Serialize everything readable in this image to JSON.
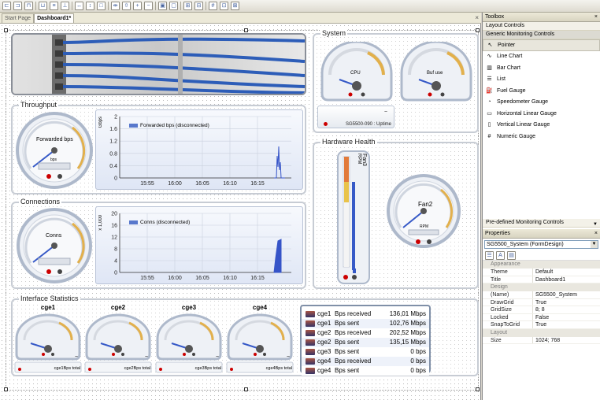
{
  "tabs": [
    {
      "label": "Start Page"
    },
    {
      "label": "Dashboard1*"
    }
  ],
  "panels": {
    "system": "System",
    "throughput": "Throughput",
    "connections": "Connections",
    "hardware_health": "Hardware Health",
    "interface_statistics": "Interface Statistics"
  },
  "system": {
    "cpu_label": "CPU",
    "buf_label": "Buf use",
    "uptime_label": "SG5500-090 : Uptime"
  },
  "throughput": {
    "gauge_label": "Forwarded bps",
    "gauge_sub": "bps",
    "chart_data": {
      "type": "line",
      "ylabel": "Gbps",
      "y_ticks": [
        "2",
        "1.6",
        "1.2",
        "0.8",
        "0.4",
        "0"
      ],
      "x_ticks": [
        "15:55",
        "16:00",
        "16:05",
        "16:10",
        "16:15"
      ],
      "legend": "Forwarded bps (disconnected)",
      "ylim": [
        0,
        2
      ]
    }
  },
  "connections": {
    "gauge_label": "Conns",
    "chart_data": {
      "type": "area",
      "ylabel": "x 1,000",
      "y_ticks": [
        "20",
        "16",
        "12",
        "8",
        "4",
        "0"
      ],
      "x_ticks": [
        "15:55",
        "16:00",
        "16:05",
        "16:10",
        "16:15"
      ],
      "legend": "Conns (disconnected)",
      "ylim": [
        0,
        20
      ]
    }
  },
  "hardware": {
    "fan3_label": "Fan3",
    "rpm_label": "RPM",
    "fan2_label": "Fan2",
    "fan2_rpm": "RPM"
  },
  "interfaces": [
    {
      "name": "cge1",
      "footer": "cge1Bps total"
    },
    {
      "name": "cge2",
      "footer": "cge2Bps total"
    },
    {
      "name": "cge3",
      "footer": "cge3Bps total"
    },
    {
      "name": "cge4",
      "footer": "cge4Bps total"
    }
  ],
  "interface_table": [
    {
      "name": "cge1",
      "metric": "Bps received",
      "value": "136,01 Mbps"
    },
    {
      "name": "cge1",
      "metric": "Bps sent",
      "value": "102,76 Mbps"
    },
    {
      "name": "cge2",
      "metric": "Bps received",
      "value": "202,52 Mbps"
    },
    {
      "name": "cge2",
      "metric": "Bps sent",
      "value": "135,15 Mbps"
    },
    {
      "name": "cge3",
      "metric": "Bps sent",
      "value": "0 bps"
    },
    {
      "name": "cge4",
      "metric": "Bps received",
      "value": "0 bps"
    },
    {
      "name": "cge4",
      "metric": "Bps sent",
      "value": "0 bps"
    }
  ],
  "toolbox": {
    "title": "Toolbox",
    "sections": [
      "Layout Controls",
      "Generic Monitoring Controls"
    ],
    "items": [
      {
        "label": "Pointer",
        "icon": "pointer-icon"
      },
      {
        "label": "Line Chart",
        "icon": "line-chart-icon"
      },
      {
        "label": "Bar Chart",
        "icon": "bar-chart-icon"
      },
      {
        "label": "List",
        "icon": "list-icon"
      },
      {
        "label": "Fuel Gauge",
        "icon": "fuel-gauge-icon"
      },
      {
        "label": "Speedometer Gauge",
        "icon": "speedometer-icon"
      },
      {
        "label": "Horizontal Linear Gauge",
        "icon": "horizontal-gauge-icon"
      },
      {
        "label": "Vertical Linear Gauge",
        "icon": "vertical-gauge-icon"
      },
      {
        "label": "Numeric Gauge",
        "icon": "numeric-gauge-icon"
      }
    ],
    "footer_section": "Pre-defined Monitoring Controls"
  },
  "properties": {
    "title": "Properties",
    "object": "SG5500_System (FormDesign)",
    "categories": [
      {
        "name": "Appearance",
        "rows": [
          {
            "k": "Theme",
            "v": "Default"
          },
          {
            "k": "Title",
            "v": "Dashboard1"
          }
        ]
      },
      {
        "name": "Design",
        "rows": [
          {
            "k": "(Name)",
            "v": "SG5500_System"
          },
          {
            "k": "DrawGrid",
            "v": "True"
          },
          {
            "k": "GridSize",
            "v": "8; 8"
          },
          {
            "k": "Locked",
            "v": "False"
          },
          {
            "k": "SnapToGrid",
            "v": "True"
          }
        ]
      },
      {
        "name": "Layout",
        "rows": [
          {
            "k": "Size",
            "v": "1024; 768"
          }
        ]
      }
    ]
  }
}
